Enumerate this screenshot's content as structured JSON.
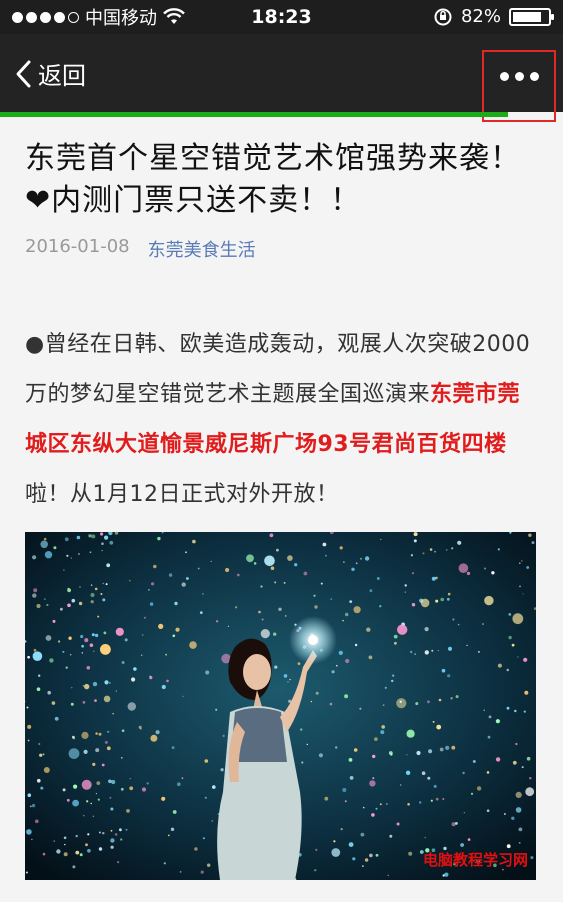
{
  "status_bar": {
    "carrier": "中国移动",
    "time": "18:23",
    "battery_percent": "82%",
    "battery_level": 0.82
  },
  "nav": {
    "back_label": "返回"
  },
  "article": {
    "title": "东莞首个星空错觉艺术馆强势来袭！❤内测门票只送不卖！！",
    "date": "2016-01-08",
    "author": "东莞美食生活",
    "para_prefix": "●曾经在日韩、欧美造成轰动，观展人次突破2000万的梦幻星空错觉艺术主题展全国巡演来",
    "para_highlight": "东莞市莞城区东纵大道愉景威尼斯广场93号君尚百货四楼",
    "para_suffix": "啦！从1月12日正式对外开放！"
  },
  "watermark": "电脑教程学习网"
}
